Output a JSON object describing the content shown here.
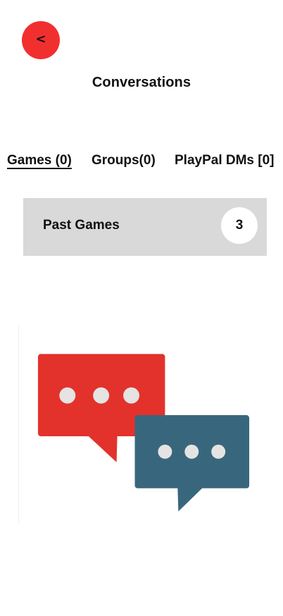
{
  "header": {
    "back_label": "<",
    "title": "Conversations"
  },
  "tabs": [
    {
      "label": "Games (0)",
      "active": true
    },
    {
      "label": "Groups(0)",
      "active": false
    },
    {
      "label": "PlayPal DMs [0]",
      "active": false
    }
  ],
  "past_games": {
    "label": "Past Games",
    "count": "3"
  },
  "icons": {
    "back": "chevron-left-icon",
    "illustration": "chat-bubbles-icon"
  },
  "colors": {
    "accent_red": "#f22f2f",
    "bubble_red": "#e3322c",
    "bubble_blue": "#38677d",
    "panel_gray": "#d9d9d9",
    "dot": "#e6e3e3"
  }
}
